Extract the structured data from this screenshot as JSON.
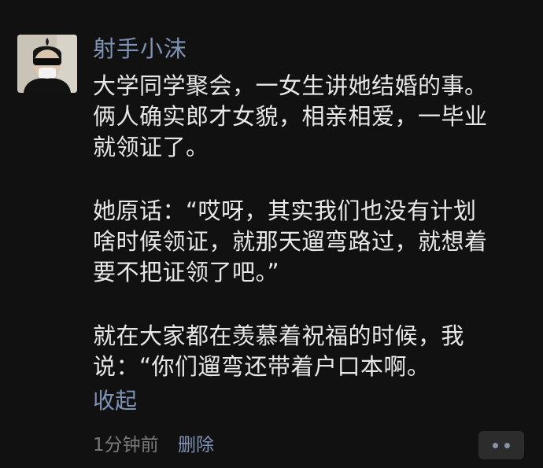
{
  "post": {
    "username": "射手小沫",
    "avatar_icon": "user-avatar-photo",
    "paragraphs": [
      {
        "lines": [
          "大学同学聚会，一女生讲她结婚的事。",
          "俩人确实郎才女貌，相亲相爱，一毕业",
          "就领证了。"
        ]
      },
      {
        "lines": [
          "她原话：“哎呀，其实我们也没有计划",
          "啥时候领证，就那天遛弯路过，就想着",
          "要不把证领了吧。”"
        ]
      },
      {
        "lines": [
          "就在大家都在羡慕着祝福的时候，我",
          "说：“你们遛弯还带着户口本啊。"
        ]
      }
    ],
    "collapse_label": "收起",
    "timestamp": "1分钟前",
    "delete_label": "删除",
    "more_icon": "more-dots-icon"
  },
  "colors": {
    "background": "#111111",
    "text": "#e8e8e8",
    "link": "#7e93b5",
    "meta": "#7a7a7a",
    "button_bg": "#2c2c2c"
  }
}
